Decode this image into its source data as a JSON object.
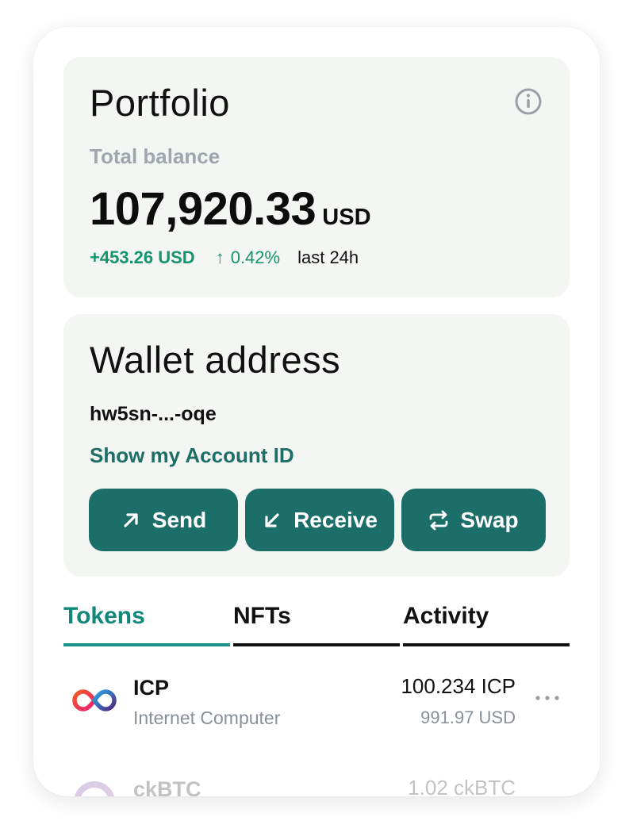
{
  "portfolio": {
    "title": "Portfolio",
    "total_label": "Total balance",
    "balance": "107,920.33",
    "currency": "USD",
    "change_usd": "+453.26 USD",
    "change_pct": "0.42%",
    "period": "last 24h",
    "info_icon": "info-icon"
  },
  "wallet": {
    "title": "Wallet address",
    "address": "hw5sn-...-oqe",
    "show_account_label": "Show my Account ID",
    "actions": [
      {
        "label": "Send",
        "icon": "arrow-up-right-icon"
      },
      {
        "label": "Receive",
        "icon": "arrow-down-left-icon"
      },
      {
        "label": "Swap",
        "icon": "swap-icon"
      }
    ]
  },
  "tabs": [
    {
      "label": "Tokens",
      "active": true
    },
    {
      "label": "NFTs",
      "active": false
    },
    {
      "label": "Activity",
      "active": false
    }
  ],
  "tokens": [
    {
      "symbol": "ICP",
      "name": "Internet Computer",
      "balance": "100.234 ICP",
      "usd": "991.97 USD"
    },
    {
      "symbol": "ckBTC",
      "name": "",
      "balance": "1.02 ckBTC",
      "usd": ""
    }
  ],
  "colors": {
    "accent": "#1c6f68",
    "positive": "#15946e",
    "card_bg": "#f4f6f4",
    "muted": "#a0a6ad"
  }
}
